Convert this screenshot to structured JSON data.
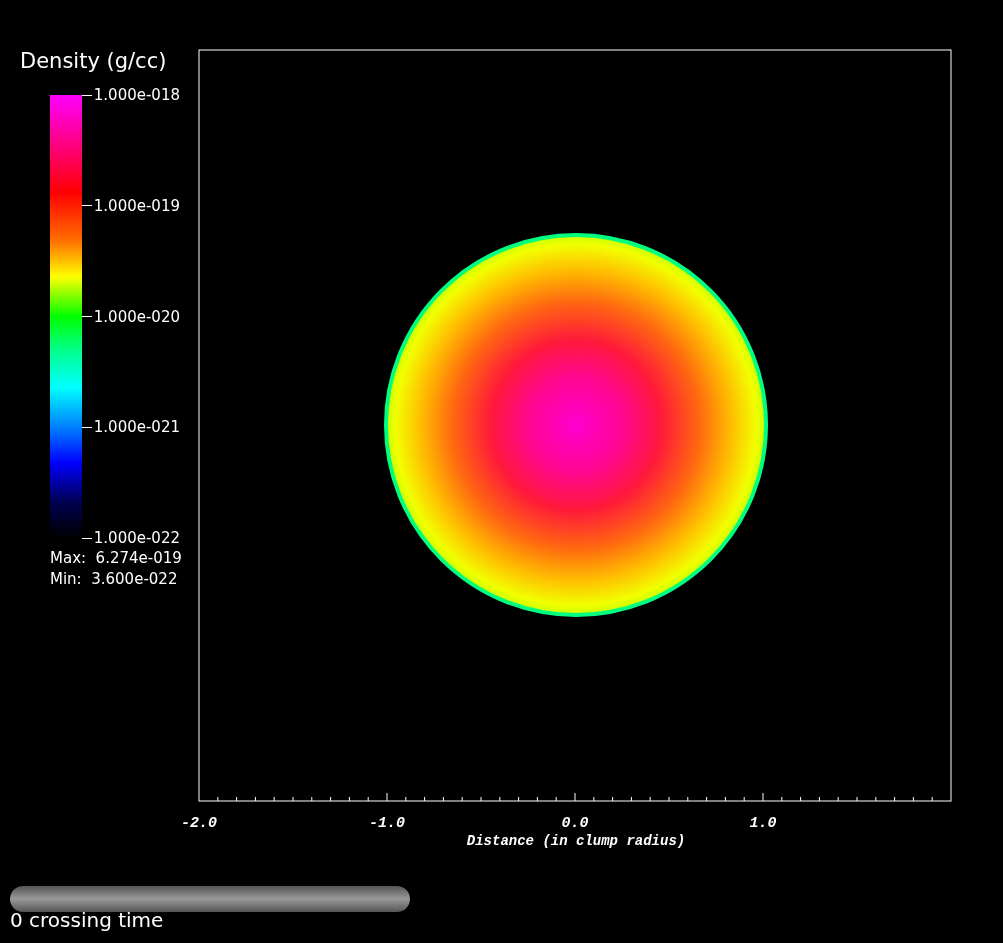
{
  "legend": {
    "title": "Density (g/cc)",
    "ticks": [
      "1.000e-018",
      "1.000e-019",
      "1.000e-020",
      "1.000e-021",
      "1.000e-022"
    ],
    "max": "Max:  6.274e-019",
    "min": "Min:  3.600e-022"
  },
  "plot": {
    "xticks": [
      "-2.0",
      "-1.0",
      "0.0",
      "1.0"
    ],
    "xlabel": "Distance (in clump radius)"
  },
  "time_slider": {
    "level": 0,
    "label": "0 crossing time"
  }
}
